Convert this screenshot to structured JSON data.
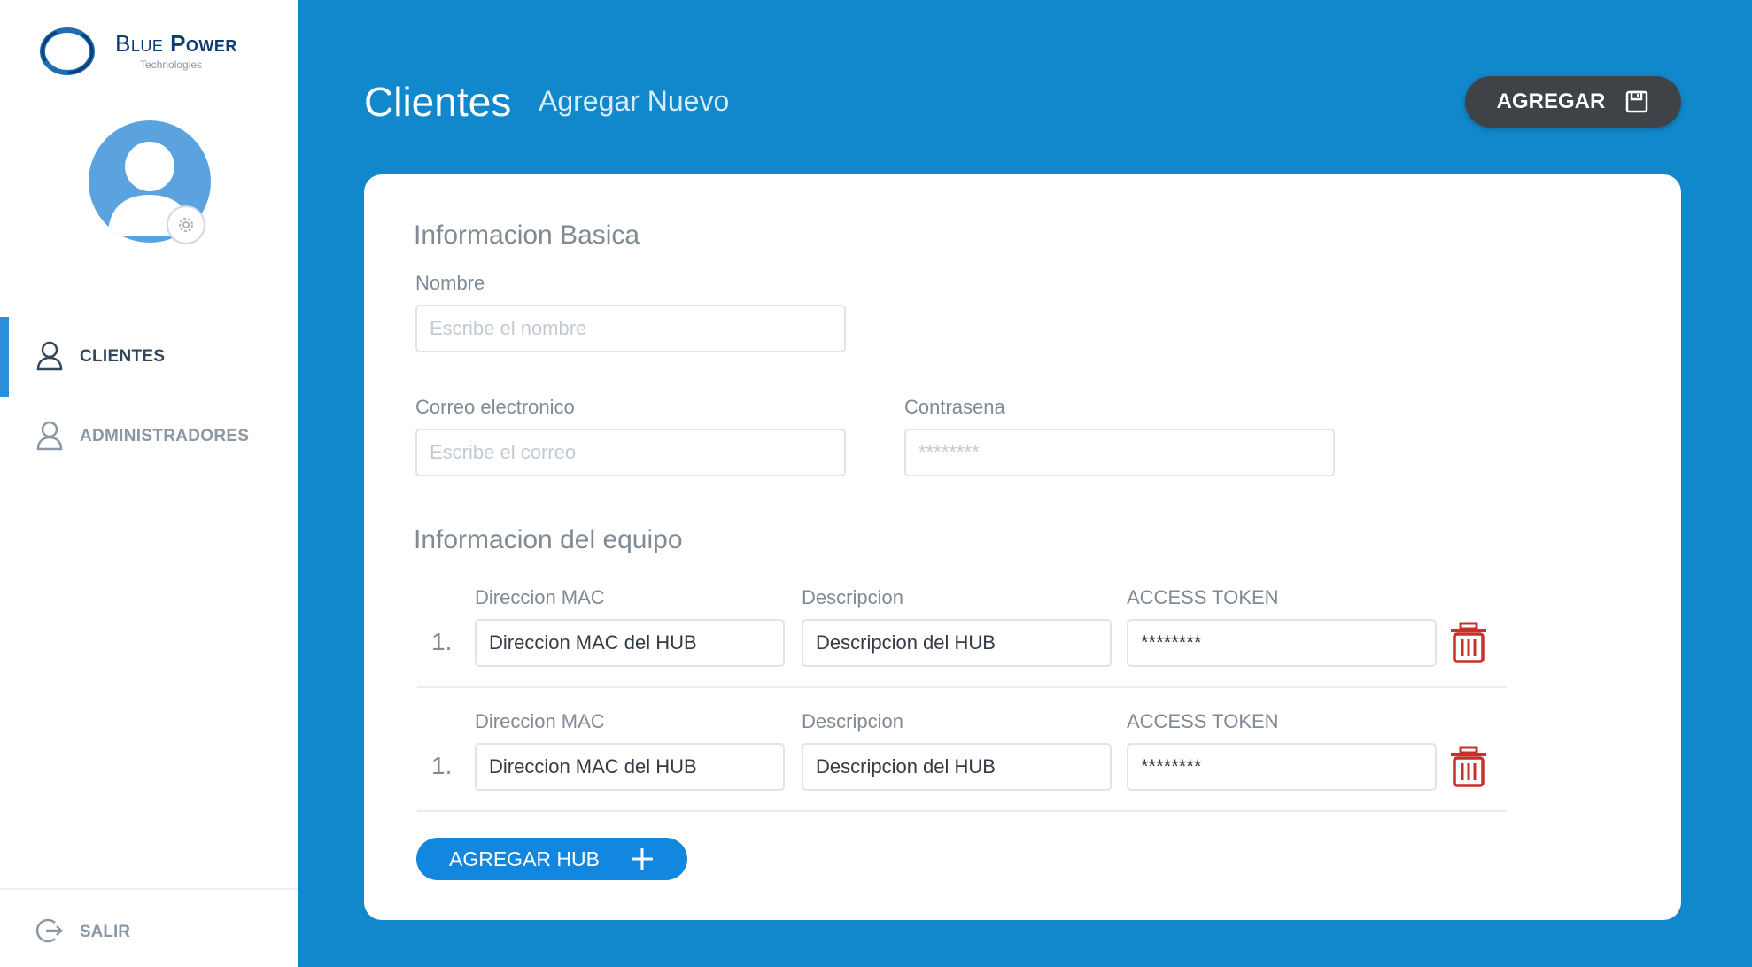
{
  "brand": {
    "name_first": "Blue",
    "name_second": "Power",
    "tagline": "Technologies",
    "color": "#0d3c73"
  },
  "sidebar": {
    "items": [
      {
        "label": "CLIENTES",
        "icon": "user-icon",
        "active": true
      },
      {
        "label": "ADMINISTRADORES",
        "icon": "user-icon",
        "active": false
      }
    ],
    "logout_label": "SALIR"
  },
  "header": {
    "title": "Clientes",
    "subtitle": "Agregar Nuevo",
    "add_button_label": "AGREGAR",
    "add_button_icon": "save-icon"
  },
  "form": {
    "basic_section_title": "Informacion Basica",
    "name_label": "Nombre",
    "name_placeholder": "Escribe el nombre",
    "email_label": "Correo electronico",
    "email_placeholder": "Escribe el correo",
    "password_label": "Contrasena",
    "password_placeholder": "********",
    "equipment_section_title": "Informacion del equipo",
    "hubs": [
      {
        "number": "1.",
        "mac_label": "Direccion MAC",
        "mac_value": "Direccion MAC del HUB",
        "description_label": "Descripcion",
        "description_value": "Descripcion del HUB",
        "token_label": "ACCESS TOKEN",
        "token_value": "********"
      },
      {
        "number": "1.",
        "mac_label": "Direccion MAC",
        "mac_value": "Direccion MAC del HUB",
        "description_label": "Descripcion",
        "description_value": "Descripcion del HUB",
        "token_label": "ACCESS TOKEN",
        "token_value": "********"
      }
    ],
    "add_hub_label": "AGREGAR HUB"
  },
  "colors": {
    "background": "#1187cc",
    "accent": "#2b8fd9",
    "dark_button": "#3f4347",
    "delete": "#c9302c"
  }
}
